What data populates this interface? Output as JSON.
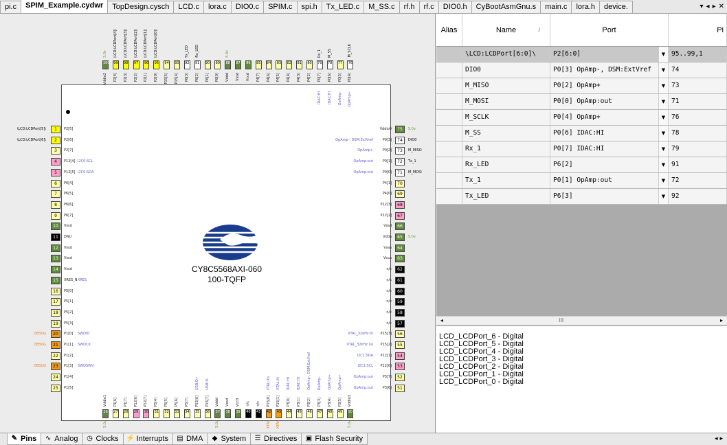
{
  "tabs": [
    "pi.c",
    "SPIM_Example.cydwr",
    "TopDesign.cysch",
    "LCD.c",
    "lora.c",
    "DIO0.c",
    "SPIM.c",
    "spi.h",
    "Tx_LED.c",
    "M_SS.c",
    "rf.h",
    "rf.c",
    "DIO0.h",
    "CyBootAsmGnu.s",
    "main.c",
    "lora.h",
    "device."
  ],
  "active_tab": "SPIM_Example.cydwr",
  "tab_nav": {
    "menu": "▾",
    "prev": "◂",
    "next": "▸",
    "close": "✕"
  },
  "chip": {
    "part": "CY8C5568AXI-060",
    "package": "100-TQFP"
  },
  "left_pins": [
    {
      "num": "1",
      "name": "P2[5]",
      "ext": "\\LCD:LCDPort[5]\\",
      "color": "#ffff00"
    },
    {
      "num": "2",
      "name": "P2[6]",
      "ext": "\\LCD:LCDPort[6]\\",
      "color": "#ffff00"
    },
    {
      "num": "3",
      "name": "P2[7]",
      "ext": "",
      "color": "#ffffa8"
    },
    {
      "num": "4",
      "name": "P12[4]",
      "alt": "I2C0:SCL",
      "ext": "",
      "color": "#ff9fc8"
    },
    {
      "num": "5",
      "name": "P12[5]",
      "alt": "I2C0:SDA",
      "ext": "",
      "color": "#ff9fc8"
    },
    {
      "num": "6",
      "name": "P6[4]",
      "ext": "",
      "color": "#ffffa8"
    },
    {
      "num": "7",
      "name": "P6[5]",
      "ext": "",
      "color": "#ffffa8"
    },
    {
      "num": "8",
      "name": "P6[6]",
      "ext": "",
      "color": "#ffffa8"
    },
    {
      "num": "9",
      "name": "P6[7]",
      "ext": "",
      "color": "#ffffa8"
    },
    {
      "num": "10",
      "name": "Vssd",
      "ext": "",
      "color": "#5f8a3a"
    },
    {
      "num": "11",
      "name": "DNU",
      "ext": "",
      "color": "#000000"
    },
    {
      "num": "12",
      "name": "Vssd",
      "ext": "",
      "color": "#5f8a3a"
    },
    {
      "num": "13",
      "name": "Vssd",
      "ext": "",
      "color": "#5f8a3a"
    },
    {
      "num": "14",
      "name": "Vssd",
      "ext": "",
      "color": "#5f8a3a"
    },
    {
      "num": "15",
      "name": "XRES_N",
      "alt": "XRES",
      "ext": "",
      "color": "#5f8a3a"
    },
    {
      "num": "16",
      "name": "P5[0]",
      "ext": "",
      "color": "#ffffa8"
    },
    {
      "num": "17",
      "name": "P5[1]",
      "ext": "",
      "color": "#ffffa8"
    },
    {
      "num": "18",
      "name": "P5[2]",
      "ext": "",
      "color": "#ffffa8"
    },
    {
      "num": "19",
      "name": "P5[3]",
      "ext": "",
      "color": "#ffffa8"
    },
    {
      "num": "20",
      "name": "P1[0]",
      "alt": "SWDIO",
      "ext": "DEBUG",
      "color": "#f39c12"
    },
    {
      "num": "21",
      "name": "P1[1]",
      "alt": "SWDCK",
      "ext": "DEBUG",
      "color": "#f39c12"
    },
    {
      "num": "22",
      "name": "P1[2]",
      "ext": "",
      "color": "#ffffa8"
    },
    {
      "num": "23",
      "name": "P1[3]",
      "alt": "SWDSWV",
      "ext": "DEBUG",
      "color": "#f39c12"
    },
    {
      "num": "24",
      "name": "P1[4]",
      "ext": "",
      "color": "#ffffa8"
    },
    {
      "num": "25",
      "name": "P1[5]",
      "ext": "",
      "color": "#ffffa8"
    }
  ],
  "right_pins": [
    {
      "num": "75",
      "name": "Vddio0",
      "ext": "5.0v",
      "color": "#5f8a3a"
    },
    {
      "num": "74",
      "name": "P0[3]",
      "alt": "OpAmp-, DSM:ExtVref",
      "ext": "DIO0",
      "color": "#ffffff"
    },
    {
      "num": "73",
      "name": "P0[2]",
      "alt": "OpAmp+",
      "ext": "M_MISO",
      "color": "#ffffff"
    },
    {
      "num": "72",
      "name": "P0[1]",
      "alt": "OpAmp:out",
      "ext": "Tx_1",
      "color": "#ffffff"
    },
    {
      "num": "71",
      "name": "P0[0]",
      "alt": "OpAmp:out",
      "ext": "M_MOSI",
      "color": "#ffffff"
    },
    {
      "num": "70",
      "name": "P4[1]",
      "ext": "",
      "color": "#ffffa8"
    },
    {
      "num": "69",
      "name": "P4[0]",
      "ext": "",
      "color": "#ffffa8"
    },
    {
      "num": "68",
      "name": "P12[3]",
      "ext": "",
      "color": "#ff9fc8"
    },
    {
      "num": "67",
      "name": "P12[2]",
      "ext": "",
      "color": "#ff9fc8"
    },
    {
      "num": "66",
      "name": "Vssd",
      "ext": "",
      "color": "#5f8a3a"
    },
    {
      "num": "65",
      "name": "Vdda",
      "ext": "5.0v",
      "color": "#5f8a3a"
    },
    {
      "num": "64",
      "name": "Vssa",
      "ext": "",
      "color": "#5f8a3a"
    },
    {
      "num": "63",
      "name": "Vcca",
      "ext": "",
      "color": "#5f8a3a"
    },
    {
      "num": "62",
      "name": "n/c",
      "ext": "",
      "color": "#000000"
    },
    {
      "num": "61",
      "name": "n/c",
      "ext": "",
      "color": "#000000"
    },
    {
      "num": "60",
      "name": "n/c",
      "ext": "",
      "color": "#000000"
    },
    {
      "num": "59",
      "name": "n/c",
      "ext": "",
      "color": "#000000"
    },
    {
      "num": "58",
      "name": "n/c",
      "ext": "",
      "color": "#000000"
    },
    {
      "num": "57",
      "name": "n/c",
      "ext": "",
      "color": "#000000"
    },
    {
      "num": "56",
      "name": "P15[3]",
      "alt": "XTAL_32kHz:Xi",
      "ext": "",
      "color": "#ffffa8"
    },
    {
      "num": "55",
      "name": "P15[2]",
      "alt": "XTAL_32kHz:Xo",
      "ext": "",
      "color": "#ffffa8"
    },
    {
      "num": "54",
      "name": "P12[1]",
      "alt": "I2C1:SDA",
      "ext": "",
      "color": "#ff9fc8"
    },
    {
      "num": "53",
      "name": "P12[0]",
      "alt": "I2C1:SCL",
      "ext": "",
      "color": "#ff9fc8"
    },
    {
      "num": "52",
      "name": "P3[7]",
      "alt": "OpAmp:out",
      "ext": "",
      "color": "#ffffa8"
    },
    {
      "num": "51",
      "name": "P3[6]",
      "alt": "OpAmp:out",
      "ext": "",
      "color": "#ffffa8"
    }
  ],
  "top_pins": [
    {
      "num": "100",
      "name": "Vddio2",
      "ext": "5.0v",
      "color": "#5f8a3a"
    },
    {
      "num": "99",
      "name": "P2[4]",
      "ext": "\\LCD:LCDPort[4]\\",
      "color": "#ffff00"
    },
    {
      "num": "98",
      "name": "P2[3]",
      "ext": "\\LCD:LCDPort[3]\\",
      "color": "#ffff00"
    },
    {
      "num": "97",
      "name": "P2[2]",
      "ext": "\\LCD:LCDPort[2]\\",
      "color": "#ffff00"
    },
    {
      "num": "96",
      "name": "P2[1]",
      "ext": "\\LCD:LCDPort[1]\\",
      "color": "#ffff00"
    },
    {
      "num": "95",
      "name": "P2[0]",
      "ext": "\\LCD:LCDPort[0]\\",
      "color": "#ffff00"
    },
    {
      "num": "94",
      "name": "P15[5]",
      "ext": "",
      "color": "#ffffa8"
    },
    {
      "num": "93",
      "name": "P15[4]",
      "ext": "",
      "color": "#ffffa8"
    },
    {
      "num": "92",
      "name": "P6[3]",
      "ext": "Tx_LED",
      "color": "#ffffff"
    },
    {
      "num": "91",
      "name": "P6[2]",
      "ext": "Rx_LED",
      "color": "#ffffff"
    },
    {
      "num": "90",
      "name": "P6[1]",
      "ext": "",
      "color": "#ffffa8"
    },
    {
      "num": "89",
      "name": "P6[0]",
      "ext": "",
      "color": "#ffffa8"
    },
    {
      "num": "88",
      "name": "Vddd",
      "ext": "5.0v",
      "color": "#5f8a3a"
    },
    {
      "num": "87",
      "name": "Vssd",
      "ext": "",
      "color": "#5f8a3a"
    },
    {
      "num": "86",
      "name": "Vccd",
      "ext": "",
      "color": "#5f8a3a"
    },
    {
      "num": "85",
      "name": "P4[7]",
      "ext": "",
      "color": "#ffffa8"
    },
    {
      "num": "84",
      "name": "P4[6]",
      "ext": "",
      "color": "#ffffa8"
    },
    {
      "num": "83",
      "name": "P4[5]",
      "ext": "",
      "color": "#ffffa8"
    },
    {
      "num": "82",
      "name": "P4[4]",
      "ext": "",
      "color": "#ffffa8"
    },
    {
      "num": "81",
      "name": "P4[3]",
      "ext": "",
      "color": "#ffffa8"
    },
    {
      "num": "80",
      "name": "P4[2]",
      "ext": "",
      "color": "#ffffa8"
    },
    {
      "num": "79",
      "name": "P0[7]",
      "alt": "IDAC:HI",
      "ext": "Rx_1",
      "color": "#ffffff"
    },
    {
      "num": "78",
      "name": "P0[6]",
      "alt": "IDAC:HI",
      "ext": "M_SS",
      "color": "#ffffff"
    },
    {
      "num": "77",
      "name": "P0[5]",
      "alt": "OpAmp-",
      "ext": "",
      "color": "#ffffa8"
    },
    {
      "num": "76",
      "name": "P0[4]",
      "alt": "OpAmp+",
      "ext": "M_SCLK",
      "color": "#ffffff"
    }
  ],
  "bottom_pins": [
    {
      "num": "26",
      "name": "Vddio1",
      "ext": "5.0v",
      "color": "#5f8a3a"
    },
    {
      "num": "27",
      "name": "P1[6]",
      "ext": "",
      "color": "#ffffa8"
    },
    {
      "num": "28",
      "name": "P1[7]",
      "ext": "",
      "color": "#ffffa8"
    },
    {
      "num": "29",
      "name": "P12[6]",
      "ext": "",
      "color": "#ff9fc8"
    },
    {
      "num": "30",
      "name": "P12[7]",
      "ext": "",
      "color": "#ff9fc8"
    },
    {
      "num": "31",
      "name": "P5[4]",
      "ext": "",
      "color": "#ffffa8"
    },
    {
      "num": "32",
      "name": "P5[5]",
      "ext": "",
      "color": "#ffffa8"
    },
    {
      "num": "33",
      "name": "P5[6]",
      "ext": "",
      "color": "#ffffa8"
    },
    {
      "num": "34",
      "name": "P5[7]",
      "ext": "",
      "color": "#ffffa8"
    },
    {
      "num": "35",
      "name": "P15[6]",
      "alt": "USB:D+",
      "ext": "",
      "color": "#ffffa8"
    },
    {
      "num": "36",
      "name": "P15[7]",
      "alt": "USB:D-",
      "ext": "",
      "color": "#ffffa8"
    },
    {
      "num": "37",
      "name": "Vddd",
      "ext": "5.0v",
      "color": "#5f8a3a"
    },
    {
      "num": "38",
      "name": "Vssd",
      "ext": "",
      "color": "#5f8a3a"
    },
    {
      "num": "39",
      "name": "Vccd",
      "ext": "",
      "color": "#5f8a3a"
    },
    {
      "num": "40",
      "name": "n/c",
      "ext": "",
      "color": "#000000"
    },
    {
      "num": "41",
      "name": "n/c",
      "ext": "",
      "color": "#000000"
    },
    {
      "num": "42",
      "name": "P15[0]",
      "alt": "XTAL:Xo",
      "ext": "XTAL",
      "color": "#f39c12"
    },
    {
      "num": "43",
      "name": "P15[1]",
      "alt": "XTAL:Xi",
      "ext": "XTAL",
      "color": "#f39c12"
    },
    {
      "num": "44",
      "name": "P3[0]",
      "alt": "IDAC:HI",
      "ext": "",
      "color": "#ffffa8"
    },
    {
      "num": "45",
      "name": "P3[1]",
      "alt": "IDAC:HI",
      "ext": "",
      "color": "#ffffa8"
    },
    {
      "num": "46",
      "name": "P3[2]",
      "alt": "OpAmp-, DSM:ExtVref",
      "ext": "",
      "color": "#ffffa8"
    },
    {
      "num": "47",
      "name": "P3[3]",
      "alt": "OpAmp-",
      "ext": "",
      "color": "#ffffa8"
    },
    {
      "num": "48",
      "name": "P3[4]",
      "alt": "OpAmp+",
      "ext": "",
      "color": "#ffffa8"
    },
    {
      "num": "49",
      "name": "P3[5]",
      "alt": "OpAmp+",
      "ext": "",
      "color": "#ffffa8"
    },
    {
      "num": "50",
      "name": "Vddio3",
      "ext": "5.0v",
      "color": "#5f8a3a"
    }
  ],
  "grid": {
    "headers": {
      "alias": "Alias",
      "name": "Name",
      "sort": "/",
      "port": "Port",
      "pin": "Pi"
    },
    "rows": [
      {
        "name": "\\LCD:LCDPort[6:0]\\",
        "port": "P2[6:0]",
        "pin": "95..99,1",
        "selected": true
      },
      {
        "name": "DIO0",
        "port": "P0[3] OpAmp-, DSM:ExtVref",
        "pin": "74"
      },
      {
        "name": "M_MISO",
        "port": "P0[2] OpAmp+",
        "pin": "73"
      },
      {
        "name": "M_MOSI",
        "port": "P0[0] OpAmp:out",
        "pin": "71"
      },
      {
        "name": "M_SCLK",
        "port": "P0[4] OpAmp+",
        "pin": "76"
      },
      {
        "name": "M_SS",
        "port": "P0[6] IDAC:HI",
        "pin": "78"
      },
      {
        "name": "Rx_1",
        "port": "P0[7] IDAC:HI",
        "pin": "79"
      },
      {
        "name": "Rx_LED",
        "port": "P6[2]",
        "pin": "91"
      },
      {
        "name": "Tx_1",
        "port": "P0[1] OpAmp:out",
        "pin": "72"
      },
      {
        "name": "Tx_LED",
        "port": "P6[3]",
        "pin": "92"
      }
    ],
    "dropdown_glyph": "▼"
  },
  "hscroll": {
    "left": "◂",
    "thumb": "III",
    "right": "▸"
  },
  "signals": [
    "LCD_LCDPort_6 - Digital",
    "LCD_LCDPort_5 - Digital",
    "LCD_LCDPort_4 - Digital",
    "LCD_LCDPort_3 - Digital",
    "LCD_LCDPort_2 - Digital",
    "LCD_LCDPort_1 - Digital",
    "LCD_LCDPort_0 - Digital"
  ],
  "bottom_tabs": [
    {
      "label": "Pins",
      "icon": "pins-icon",
      "glyph": "✎",
      "active": true
    },
    {
      "label": "Analog",
      "icon": "analog-icon",
      "glyph": "∿"
    },
    {
      "label": "Clocks",
      "icon": "clock-icon",
      "glyph": "◷"
    },
    {
      "label": "Interrupts",
      "icon": "interrupt-icon",
      "glyph": "⚡"
    },
    {
      "label": "DMA",
      "icon": "dma-icon",
      "glyph": "▤"
    },
    {
      "label": "System",
      "icon": "system-icon",
      "glyph": "◆"
    },
    {
      "label": "Directives",
      "icon": "directives-icon",
      "glyph": "☰"
    },
    {
      "label": "Flash Security",
      "icon": "lock-icon",
      "glyph": "▣"
    }
  ],
  "bottom_nav": "◂ ▸"
}
